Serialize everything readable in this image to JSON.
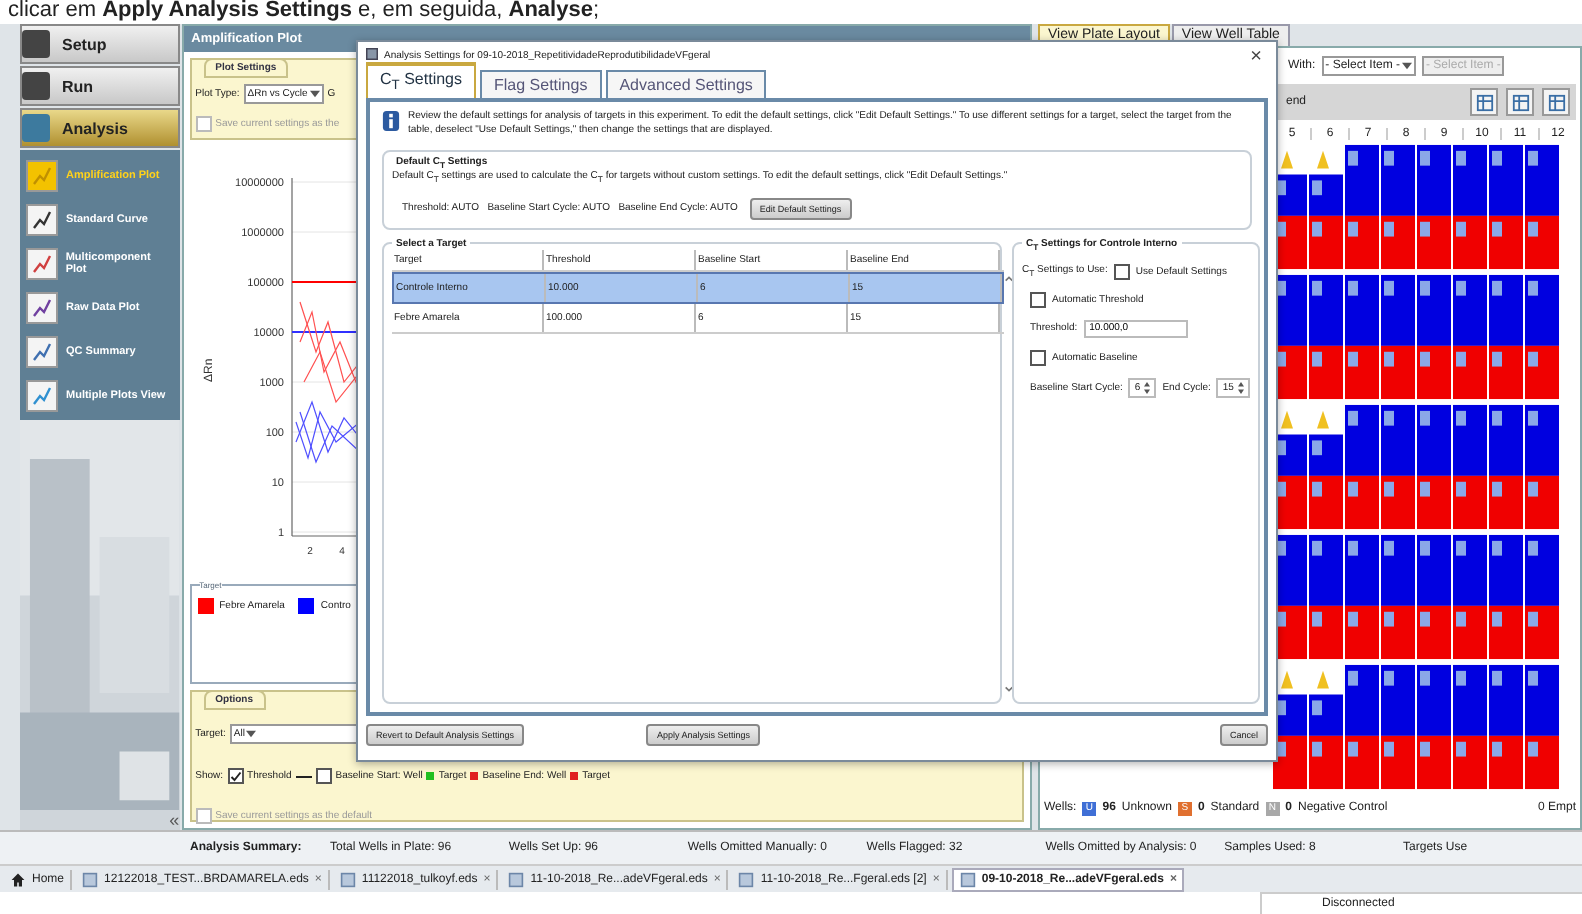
{
  "caption": "clicar em **Apply Analysis Settings** e, em seguida, **Analyse**;",
  "nav": {
    "steps": [
      {
        "label": "Setup",
        "selected": false
      },
      {
        "label": "Run",
        "selected": false
      },
      {
        "label": "Analysis",
        "selected": true
      }
    ],
    "items": [
      {
        "label": "Amplification Plot",
        "selected": true
      },
      {
        "label": "Standard Curve",
        "selected": false
      },
      {
        "label": "Multicomponent Plot",
        "selected": false
      },
      {
        "label": "Raw Data Plot",
        "selected": false
      },
      {
        "label": "QC Summary",
        "selected": false
      },
      {
        "label": "Multiple Plots View",
        "selected": false
      }
    ],
    "collapse": "«"
  },
  "plot_panel": {
    "title": "Amplification Plot",
    "settings_tab": "Plot Settings",
    "plot_type_label": "Plot Type:",
    "plot_type": "ΔRn vs Cycle",
    "graph_label": "G",
    "save_top": {
      "label": "Save current settings as the",
      "checked": false
    },
    "chart": {
      "ylabel": "ΔRn",
      "yticks": [
        "10000000",
        "1000000",
        "100000",
        "10000",
        "1000",
        "100",
        "10",
        "1"
      ],
      "xticks": [
        "2",
        "4"
      ]
    },
    "legend": {
      "title": "Target",
      "items": [
        {
          "label": "Febre Amarela",
          "color": "#ff0000"
        },
        {
          "label": "Contro",
          "color": "#0000ff"
        }
      ]
    },
    "options": {
      "tab": "Options",
      "target_label": "Target:",
      "target": "All",
      "show_label": "Show:",
      "threshold": {
        "label": "Threshold",
        "checked": true
      },
      "baseline": {
        "label": "Baseline Start: Well",
        "checked": false
      },
      "markers": [
        {
          "label": "Target",
          "color": "#20c020"
        },
        {
          "label": "Baseline End: Well",
          "color": "#e02020"
        },
        {
          "label": "Target",
          "color": "#e02020"
        }
      ],
      "save_default": {
        "label": "Save current settings as the default",
        "checked": false
      }
    }
  },
  "plate": {
    "tabs": [
      {
        "label": "View Plate Layout",
        "selected": true
      },
      {
        "label": "View Well Table",
        "selected": false
      }
    ],
    "with_label": "With:",
    "select_1": "- Select Item -",
    "select_2": "- Select Item -",
    "legend_button": "end",
    "columns": [
      "5",
      "6",
      "7",
      "8",
      "9",
      "10",
      "11",
      "12"
    ],
    "wells_label": "Wells:",
    "well_types": [
      {
        "letter": "U",
        "count": "96",
        "label": "Unknown",
        "color": "#3f6fd6"
      },
      {
        "letter": "S",
        "count": "0",
        "label": "Standard",
        "color": "#e07030"
      },
      {
        "letter": "N",
        "count": "0",
        "label": "Negative Control",
        "color": "#a8a8a8"
      }
    ],
    "empty": "0 Empt"
  },
  "summary": {
    "title": "Analysis Summary:",
    "items": [
      "Total Wells in Plate: 96",
      "Wells Set Up: 96",
      "Wells Omitted Manually: 0",
      "Wells Flagged: 32",
      "Wells Omitted by Analysis: 0",
      "Samples Used: 8",
      "Targets Use"
    ]
  },
  "file_tabs": [
    {
      "label": "Home",
      "kind": "home",
      "selected": false
    },
    {
      "label": "12122018_TEST...BRDAMARELA.eds",
      "kind": "file",
      "close": "×",
      "selected": false
    },
    {
      "label": "11122018_tulkoyf.eds",
      "kind": "file",
      "close": "×",
      "selected": false
    },
    {
      "label": "11-10-2018_Re...adeVFgeral.eds",
      "kind": "file",
      "close": "×",
      "selected": false
    },
    {
      "label": "11-10-2018_Re...Fgeral.eds [2]",
      "kind": "file",
      "close": "×",
      "selected": false
    },
    {
      "label": "09-10-2018_Re...adeVFgeral.eds",
      "kind": "file",
      "close": "×",
      "selected": true
    }
  ],
  "status": "Disconnected",
  "dialog": {
    "title": "Analysis Settings for 09-10-2018_RepetitividadeReprodutibilidadeVFgeral",
    "close": "×",
    "tabs": [
      {
        "label": "C$_{T}$ Settings",
        "selected": true
      },
      {
        "label": "Flag Settings",
        "selected": false
      },
      {
        "label": "Advanced Settings",
        "selected": false
      }
    ],
    "info": "Review the default settings for analysis of targets in this experiment. To edit the default settings, click \"Edit Default Settings.\" To use different settings for a target, select the target from the table, deselect \"Use Default Settings,\" then change the settings that are displayed.",
    "default_group": {
      "title": "Default C$_{T}$ Settings",
      "text": "Default C$_{T}$ settings are used to calculate the C$_{T}$ for targets without custom settings. To edit the default settings, click \"Edit Default Settings.\"",
      "values": "Threshold: AUTO   Baseline Start Cycle: AUTO   Baseline End Cycle: AUTO",
      "edit_button": "Edit Default Settings"
    },
    "targets": {
      "title": "Select a Target",
      "columns": [
        "Target",
        "Threshold",
        "Baseline Start",
        "Baseline End"
      ],
      "rows": [
        {
          "cells": [
            "Controle Interno",
            "10.000",
            "6",
            "15"
          ],
          "selected": true
        },
        {
          "cells": [
            "Febre Amarela",
            "100.000",
            "6",
            "15"
          ],
          "selected": false
        }
      ]
    },
    "ct_group": {
      "title": "C$_{T}$ Settings for Controle Interno",
      "use_label": "C$_{T}$ Settings to Use:",
      "use_default": {
        "label": "Use Default Settings",
        "checked": false
      },
      "auto_threshold": {
        "label": "Automatic Threshold",
        "checked": false
      },
      "threshold_label": "Threshold:",
      "threshold": "10.000,0",
      "auto_baseline": {
        "label": "Automatic Baseline",
        "checked": false
      },
      "start_label": "Baseline Start Cycle:",
      "start": "6",
      "end_label": "End Cycle:",
      "end": "15"
    },
    "buttons": {
      "revert": "Revert to Default Analysis Settings",
      "apply": "Apply Analysis Settings",
      "cancel": "Cancel"
    }
  }
}
